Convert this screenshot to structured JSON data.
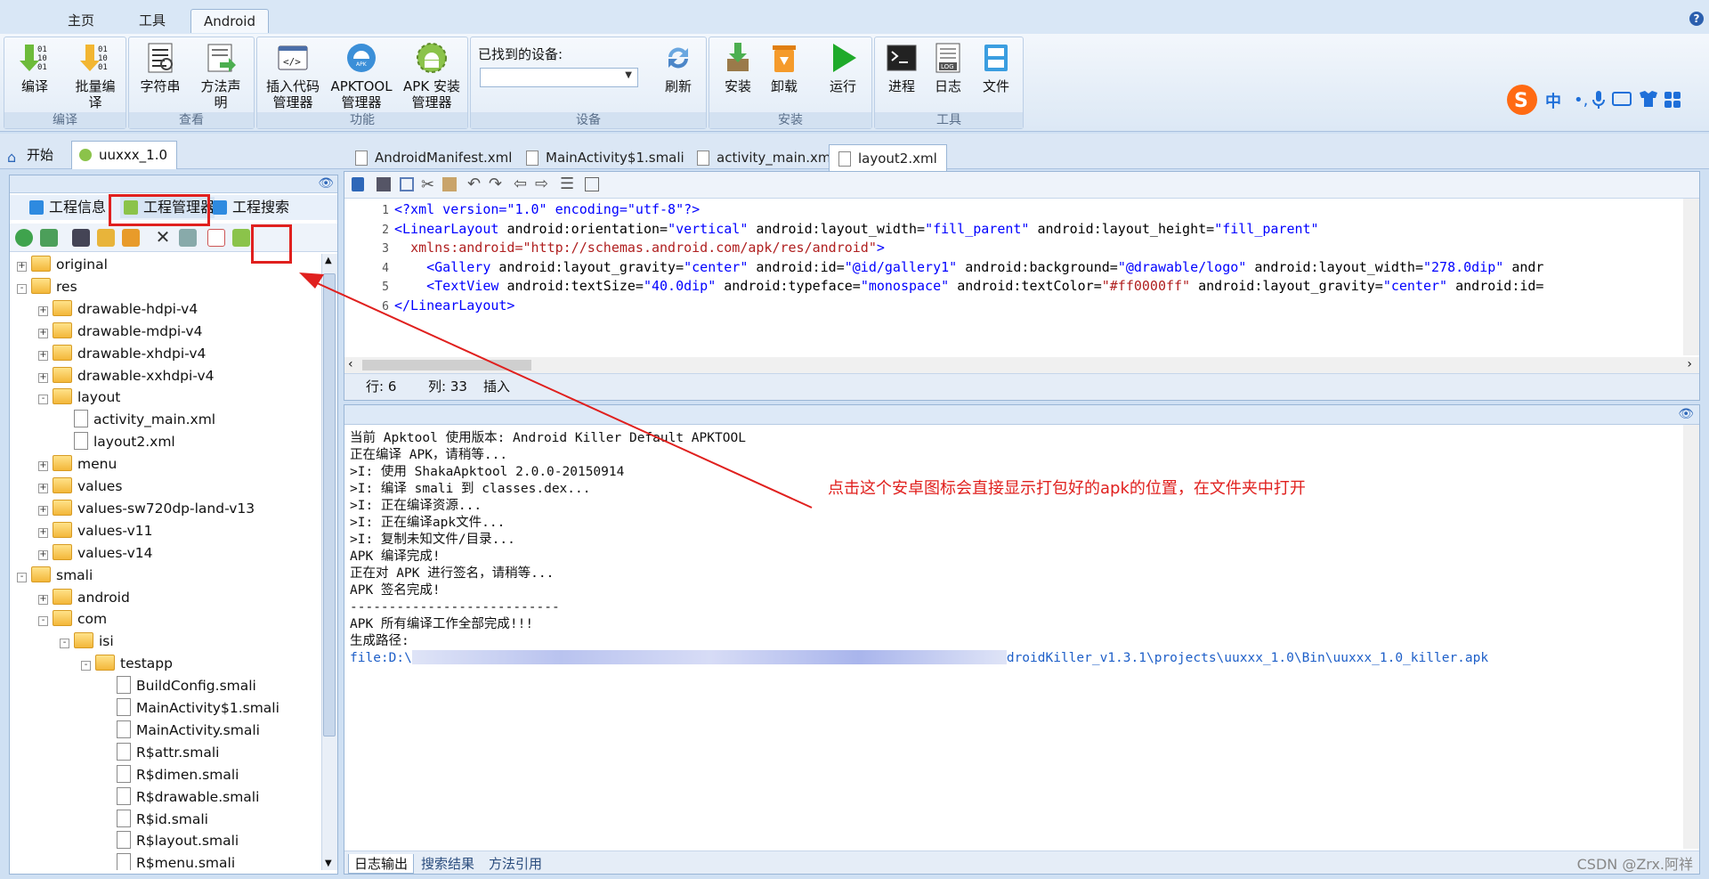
{
  "ribbon_tabs": [
    "主页",
    "工具",
    "Android"
  ],
  "ribbon_groups": [
    {
      "label": "编译",
      "buttons": [
        "编译",
        "批量编译"
      ]
    },
    {
      "label": "查看",
      "buttons": [
        "字符串",
        "方法声明"
      ]
    },
    {
      "label": "功能",
      "buttons": [
        "插入代码管理器",
        "APKTOOL管理器",
        "APK 安装管理器"
      ]
    },
    {
      "label": "设备",
      "device_label": "已找到的设备:",
      "buttons": [
        "刷新"
      ]
    },
    {
      "label": "安装",
      "buttons": [
        "安装",
        "卸载",
        "运行"
      ]
    },
    {
      "label": "工具",
      "buttons": [
        "进程",
        "日志",
        "文件"
      ]
    }
  ],
  "doc_tabs_top": [
    "开始",
    "uuxxx_1.0"
  ],
  "editor_tabs": [
    "AndroidManifest.xml",
    "MainActivity$1.smali",
    "activity_main.xml",
    "layout2.xml"
  ],
  "left_tabs": [
    "工程信息",
    "工程管理器",
    "工程搜索"
  ],
  "tree": [
    {
      "label": "original",
      "type": "folder",
      "depth": 0,
      "exp": "+"
    },
    {
      "label": "res",
      "type": "folder",
      "depth": 0,
      "exp": "-"
    },
    {
      "label": "drawable-hdpi-v4",
      "type": "folder",
      "depth": 1,
      "exp": "+"
    },
    {
      "label": "drawable-mdpi-v4",
      "type": "folder",
      "depth": 1,
      "exp": "+"
    },
    {
      "label": "drawable-xhdpi-v4",
      "type": "folder",
      "depth": 1,
      "exp": "+"
    },
    {
      "label": "drawable-xxhdpi-v4",
      "type": "folder",
      "depth": 1,
      "exp": "+"
    },
    {
      "label": "layout",
      "type": "folder",
      "depth": 1,
      "exp": "-"
    },
    {
      "label": "activity_main.xml",
      "type": "file",
      "depth": 2
    },
    {
      "label": "layout2.xml",
      "type": "file",
      "depth": 2
    },
    {
      "label": "menu",
      "type": "folder",
      "depth": 1,
      "exp": "+"
    },
    {
      "label": "values",
      "type": "folder",
      "depth": 1,
      "exp": "+"
    },
    {
      "label": "values-sw720dp-land-v13",
      "type": "folder",
      "depth": 1,
      "exp": "+"
    },
    {
      "label": "values-v11",
      "type": "folder",
      "depth": 1,
      "exp": "+"
    },
    {
      "label": "values-v14",
      "type": "folder",
      "depth": 1,
      "exp": "+"
    },
    {
      "label": "smali",
      "type": "folder",
      "depth": 0,
      "exp": "-"
    },
    {
      "label": "android",
      "type": "folder",
      "depth": 1,
      "exp": "+"
    },
    {
      "label": "com",
      "type": "folder",
      "depth": 1,
      "exp": "-"
    },
    {
      "label": "isi",
      "type": "folder",
      "depth": 2,
      "exp": "-"
    },
    {
      "label": "testapp",
      "type": "folder",
      "depth": 3,
      "exp": "-"
    },
    {
      "label": "BuildConfig.smali",
      "type": "file",
      "depth": 4
    },
    {
      "label": "MainActivity$1.smali",
      "type": "file",
      "depth": 4
    },
    {
      "label": "MainActivity.smali",
      "type": "file",
      "depth": 4
    },
    {
      "label": "R$attr.smali",
      "type": "file",
      "depth": 4
    },
    {
      "label": "R$dimen.smali",
      "type": "file",
      "depth": 4
    },
    {
      "label": "R$drawable.smali",
      "type": "file",
      "depth": 4
    },
    {
      "label": "R$id.smali",
      "type": "file",
      "depth": 4
    },
    {
      "label": "R$layout.smali",
      "type": "file",
      "depth": 4
    },
    {
      "label": "R$menu.smali",
      "type": "file",
      "depth": 4
    }
  ],
  "code_lines": [
    [
      [
        "tg",
        "<?xml version=\"1.0\" encoding=\"utf-8\"?>"
      ]
    ],
    [
      [
        "tg",
        "<LinearLayout "
      ],
      [
        "at",
        "android:orientation="
      ],
      [
        "tg",
        "\"vertical\" "
      ],
      [
        "at",
        "android:layout_width="
      ],
      [
        "tg",
        "\"fill_parent\" "
      ],
      [
        "at",
        "android:layout_height="
      ],
      [
        "tg",
        "\"fill_parent\""
      ]
    ],
    [
      [
        "at",
        "  "
      ],
      [
        "vl",
        "xmlns:android="
      ],
      [
        "vl",
        "\"http://schemas.android.com/apk/res/android\""
      ],
      [
        "tg",
        ">"
      ]
    ],
    [
      [
        "tg",
        "    <Gallery "
      ],
      [
        "at",
        "android:layout_gravity="
      ],
      [
        "tg",
        "\"center\" "
      ],
      [
        "at",
        "android:id="
      ],
      [
        "tg",
        "\"@id/gallery1\" "
      ],
      [
        "at",
        "android:background="
      ],
      [
        "tg",
        "\"@drawable/logo\" "
      ],
      [
        "at",
        "android:layout_width="
      ],
      [
        "tg",
        "\"278.0dip\" "
      ],
      [
        "at",
        "andr"
      ]
    ],
    [
      [
        "tg",
        "    <TextView "
      ],
      [
        "at",
        "android:textSize="
      ],
      [
        "tg",
        "\"40.0dip\" "
      ],
      [
        "at",
        "android:typeface="
      ],
      [
        "tg",
        "\"monospace\" "
      ],
      [
        "at",
        "android:textColor="
      ],
      [
        "vl",
        "\"#ff0000ff\" "
      ],
      [
        "at",
        "android:layout_gravity="
      ],
      [
        "tg",
        "\"center\" "
      ],
      [
        "at",
        "android:id="
      ]
    ],
    [
      [
        "tg",
        "</LinearLayout>"
      ]
    ]
  ],
  "status": {
    "row_label": "行: 6",
    "col_label": "列: 33",
    "mode": "插入"
  },
  "log_lines": [
    "当前 Apktool 使用版本: Android Killer Default APKTOOL",
    "正在编译 APK，请稍等...",
    ">I: 使用 ShakaApktool 2.0.0-20150914",
    ">I: 编译 smali 到 classes.dex...",
    ">I: 正在编译资源...",
    ">I: 正在编译apk文件...",
    ">I: 复制未知文件/目录...",
    "APK 编译完成!",
    "正在对 APK 进行签名，请稍等...",
    "APK 签名完成!",
    "---------------------------",
    "APK 所有编译工作全部完成!!!",
    "生成路径:"
  ],
  "log_path_prefix": "file:D:\\",
  "log_path_suffix": "droidKiller_v1.3.1\\projects\\uuxxx_1.0\\Bin\\uuxxx_1.0_killer.apk",
  "log_tabs": [
    "日志输出",
    "搜索结果",
    "方法引用"
  ],
  "annotation": "点击这个安卓图标会直接显示打包好的apk的位置，在文件夹中打开",
  "watermark": "CSDN @Zrx.阿祥",
  "colors": {
    "accent_red": "#e0201e",
    "android_green": "#8bc34a",
    "ribbon_blue": "#d9e7f6"
  }
}
